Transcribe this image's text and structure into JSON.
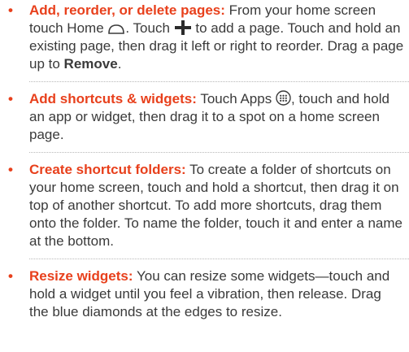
{
  "tips": [
    {
      "title": "Add, reorder, or delete pages:",
      "part1": " From your home screen touch Home ",
      "part2": ". Touch ",
      "part3": " to add a page. Touch and hold an existing page, then drag it left or right to reorder. Drag a page up to ",
      "remove_label": "Remove",
      "part4": ".",
      "icons": [
        "home-icon",
        "plus-icon"
      ]
    },
    {
      "title": "Add shortcuts & widgets:",
      "part1": " Touch Apps ",
      "part2": ", touch and hold an app or widget, then drag it to a spot on a home screen page.",
      "icons": [
        "apps-icon"
      ]
    },
    {
      "title": "Create shortcut folders:",
      "body": " To create a folder of shortcuts on your home screen, touch and hold a shortcut, then drag it on top of another shortcut. To add more shortcuts, drag them onto the folder. To name the folder, touch it and enter a name at the bottom."
    },
    {
      "title": "Resize widgets:",
      "body": " You can resize some widgets—touch and hold a widget until you feel a vibration, then release. Drag the blue diamonds at the edges to resize."
    }
  ],
  "bullet_char": "•",
  "colors": {
    "accent": "#e8401c",
    "text": "#3a3a3a",
    "separator": "#b8b8b8"
  }
}
